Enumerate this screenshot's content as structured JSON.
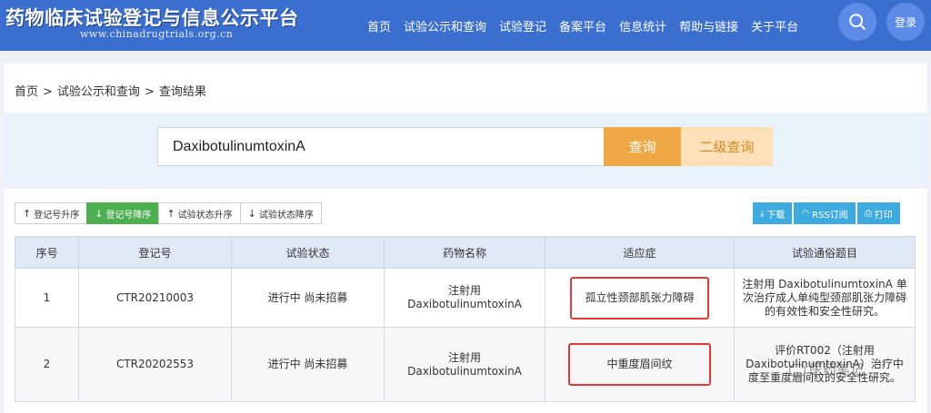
{
  "header": {
    "title": "药物临床试验登记与信息公示平台",
    "url": "www.chinadrugtrials.org.cn",
    "nav": [
      "首页",
      "试验公示和查询",
      "试验登记",
      "备案平台",
      "信息统计",
      "帮助与链接",
      "关于平台"
    ],
    "login_label": "登录"
  },
  "breadcrumb": [
    "首页",
    "试验公示和查询",
    "查询结果"
  ],
  "search": {
    "value": "DaxibotulinumtoxinA",
    "search_label": "查询",
    "advanced_label": "二级查询"
  },
  "sort_buttons": [
    {
      "label": "登记号升序",
      "arrow": "↑",
      "active": false
    },
    {
      "label": "登记号降序",
      "arrow": "↓",
      "active": true
    },
    {
      "label": "试验状态升序",
      "arrow": "↑",
      "active": false
    },
    {
      "label": "试验状态降序",
      "arrow": "↓",
      "active": false
    }
  ],
  "export_buttons": [
    {
      "label": "下载",
      "icon": "download-icon"
    },
    {
      "label": "RSS订阅",
      "icon": "rss-icon"
    },
    {
      "label": "打印",
      "icon": "print-icon"
    }
  ],
  "table": {
    "headers": [
      "序号",
      "登记号",
      "试验状态",
      "药物名称",
      "适应症",
      "试验通俗题目"
    ],
    "rows": [
      {
        "no": "1",
        "reg": "CTR20210003",
        "status": "进行中 尚未招募",
        "drug": "注射用DaxibotulinumtoxinA",
        "indication": "孤立性颈部肌张力障碍",
        "title": "注射用 DaxibotulinumtoxinA 单次治疗成人单纯型颈部肌张力障碍的有效性和安全性研究。"
      },
      {
        "no": "2",
        "reg": "CTR20202553",
        "status": "进行中 尚未招募",
        "drug": "注射用DaxibotulinumtoxinA",
        "indication": "中重度眉间纹",
        "title": "评价RT002（注射用DaxibotulinumtoxinA）治疗中度至重度眉间纹的安全性研究。"
      }
    ]
  },
  "watermark": "医药笔记",
  "colors": {
    "header_bg": "#3a6fd0",
    "search_btn": "#f0a845",
    "advanced_btn": "#fbe0b8",
    "active_sort": "#4caf50",
    "export_btn": "#3eabe0",
    "highlight": "#e53935"
  }
}
